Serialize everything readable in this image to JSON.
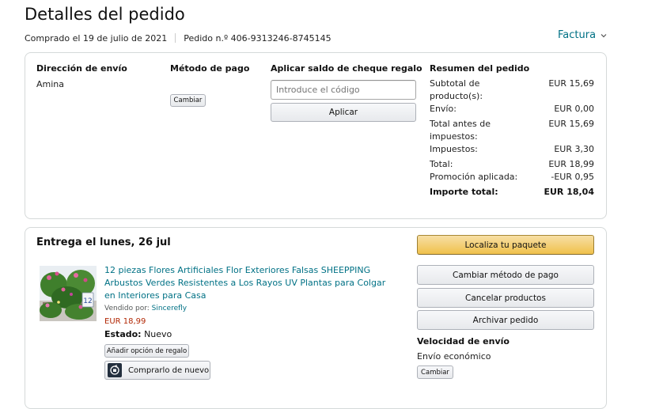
{
  "page": {
    "title": "Detalles del pedido",
    "ordered_on": "Comprado el 19 de julio de 2021",
    "order_number": "Pedido n.º 406-9313246-8745145",
    "invoice_label": "Factura"
  },
  "shipping_address": {
    "heading": "Dirección de envío",
    "name": "Amina"
  },
  "payment_method": {
    "heading": "Método de pago",
    "change_label": "Cambiar"
  },
  "gift_card": {
    "heading": "Aplicar saldo de cheque regalo",
    "placeholder": "Introduce el código",
    "apply_label": "Aplicar"
  },
  "order_summary": {
    "heading": "Resumen del pedido",
    "rows": [
      {
        "label": "Subtotal de producto(s):",
        "value": "EUR 15,69"
      },
      {
        "label": "Envío:",
        "value": "EUR 0,00"
      },
      {
        "label": "Total antes de impuestos:",
        "value": "EUR 15,69"
      },
      {
        "label": "Impuestos:",
        "value": "EUR 3,30"
      },
      {
        "label": "Total:",
        "value": "EUR 18,99"
      },
      {
        "label": "Promoción aplicada:",
        "value": "-EUR 0,95"
      },
      {
        "label": "Importe total:",
        "value": "EUR 18,04"
      }
    ]
  },
  "shipment": {
    "delivery_heading": "Entrega el lunes, 26 jul",
    "product": {
      "title": "12 piezas Flores Artificiales Flor Exteriores Falsas SHEEPPING Arbustos Verdes Resistentes a Los Rayos UV Plantas para Colgar en Interiores para Casa",
      "sold_by_label": "Vendido por:",
      "seller": "Sincerefly",
      "price": "EUR 18,99",
      "condition_label": "Estado:",
      "condition": "Nuevo",
      "gift_option_label": "Añadir opción de regalo",
      "buy_again_label": "Comprarlo de nuevo",
      "image_icon": "flower-product-image"
    },
    "actions": {
      "track": "Localiza tu paquete",
      "change_payment": "Cambiar método de pago",
      "cancel": "Cancelar productos",
      "archive": "Archivar pedido"
    },
    "shipping_speed": {
      "heading": "Velocidad de envío",
      "value": "Envío económico",
      "change_label": "Cambiar"
    }
  },
  "colors": {
    "link": "#007185",
    "price": "#b12704",
    "track_button": "#f0c14b",
    "border": "#d5d9d9"
  }
}
